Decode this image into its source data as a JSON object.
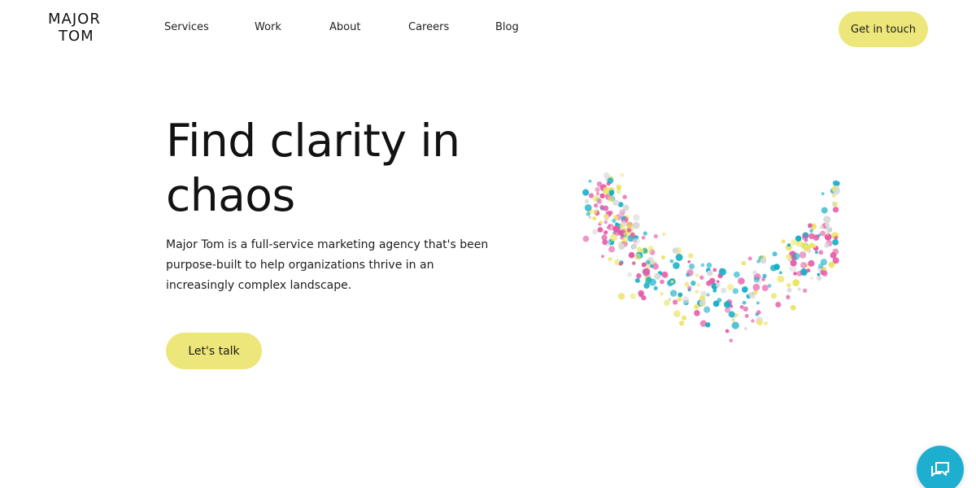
{
  "header": {
    "logo": {
      "line1": "MAJOR",
      "line2": "TOM"
    },
    "nav": [
      {
        "label": "Services"
      },
      {
        "label": "Work"
      },
      {
        "label": "About"
      },
      {
        "label": "Careers"
      },
      {
        "label": "Blog"
      }
    ],
    "cta_label": "Get in touch"
  },
  "hero": {
    "title": "Find clarity in chaos",
    "description": "Major Tom is a full-service marketing agency that's been purpose-built to help organizations thrive in an increasingly complex landscape.",
    "cta_label": "Let's talk",
    "illustration": {
      "icon": "dot-swirl-illustration",
      "colors": [
        "#e55aa8",
        "#17b0c8",
        "#ece469",
        "#d9d9d9"
      ]
    }
  },
  "chat": {
    "icon": "chat-bubbles-icon",
    "color": "#1eaed0"
  },
  "theme": {
    "accent": "#ede67a",
    "text": "#1c1c1c"
  }
}
